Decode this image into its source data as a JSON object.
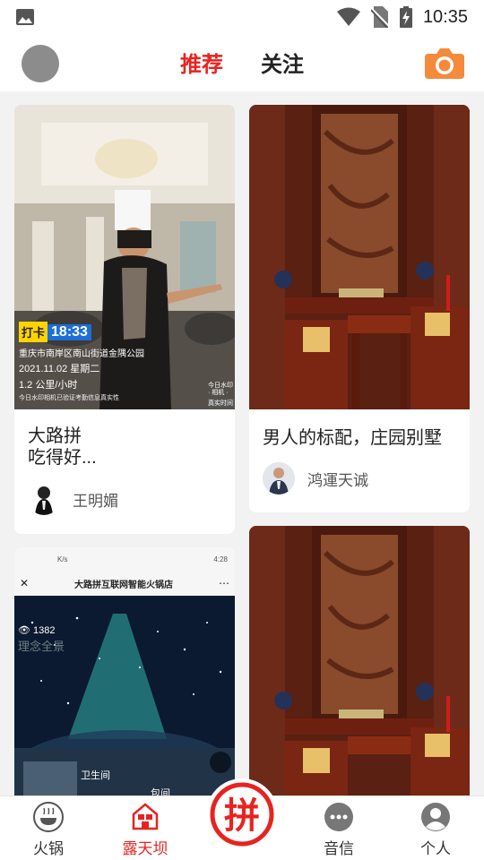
{
  "status_bar": {
    "time": "10:35"
  },
  "header": {
    "tabs": [
      {
        "label": "推荐",
        "active": true
      },
      {
        "label": "关注",
        "active": false
      }
    ],
    "accent_color": "#e8231f",
    "camera_color": "#f58a3c"
  },
  "feed": {
    "cards": [
      {
        "title": "大路拼\n吃得好...",
        "author": "王明媚",
        "overlay": {
          "badge_label": "打卡",
          "badge_time": "18:33",
          "location": "重庆市南岸区南山街道金隅公园",
          "date": "2021.11.02 星期二",
          "distance": "1.2 公里/小时",
          "watermark_note": "今日水印相机已验证考勤信息真实性",
          "watermark_corner": "今日水印\n· 相机 ·",
          "watermark_verified": "真实时间"
        }
      },
      {
        "title": "男人的标配，庄园别墅",
        "author": "鸿運天诚"
      },
      {
        "title": "",
        "author": "",
        "screenshot": {
          "status_left": "K/s",
          "status_right": "4:28",
          "page_title": "大路拼互联网智能火锅店",
          "view_count": "1382",
          "overlay_text": "理念全景",
          "label_toilet": "卫生间",
          "label_room": "包间"
        }
      },
      {
        "title": "",
        "author": ""
      }
    ]
  },
  "bottom_nav": {
    "items": [
      {
        "label": "火锅",
        "icon": "hotpot-icon",
        "active": false
      },
      {
        "label": "露天坝",
        "icon": "home-icon",
        "active": true
      },
      {
        "label": "音信",
        "icon": "chat-icon",
        "active": false
      },
      {
        "label": "个人",
        "icon": "person-icon",
        "active": false
      }
    ],
    "center_glyph": "拼"
  }
}
